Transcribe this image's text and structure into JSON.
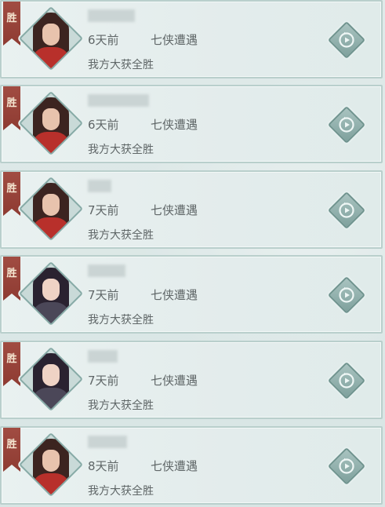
{
  "battles": [
    {
      "badge": "胜",
      "time": "6天前",
      "mode": "七侠遭遇",
      "result": "我方大获全胜",
      "avatar": "warrior",
      "name_width": 60
    },
    {
      "badge": "胜",
      "time": "6天前",
      "mode": "七侠遭遇",
      "result": "我方大获全胜",
      "avatar": "warrior",
      "name_width": 78
    },
    {
      "badge": "胜",
      "time": "7天前",
      "mode": "七侠遭遇",
      "result": "我方大获全胜",
      "avatar": "warrior",
      "name_width": 30
    },
    {
      "badge": "胜",
      "time": "7天前",
      "mode": "七侠遭遇",
      "result": "我方大获全胜",
      "avatar": "scholar",
      "name_width": 48
    },
    {
      "badge": "胜",
      "time": "7天前",
      "mode": "七侠遭遇",
      "result": "我方大获全胜",
      "avatar": "scholar",
      "name_width": 38
    },
    {
      "badge": "胜",
      "time": "8天前",
      "mode": "七侠遭遇",
      "result": "我方大获全胜",
      "avatar": "warrior",
      "name_width": 50
    }
  ],
  "icons": {
    "replay": "replay-icon"
  },
  "colors": {
    "ribbon": "#9b463d",
    "text": "#5f6667",
    "border": "#b9cfcc",
    "button": "#86aaa6"
  }
}
